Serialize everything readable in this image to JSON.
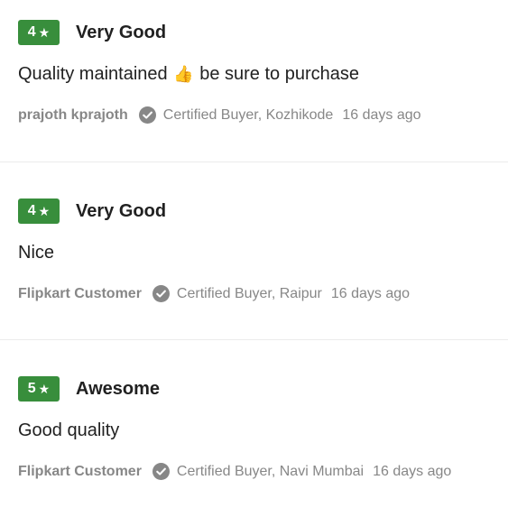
{
  "reviews": [
    {
      "rating": "4",
      "title": "Very Good",
      "body_before": "Quality maintained",
      "body_icon": "thumbs-up-icon",
      "body_after": "be sure to purchase",
      "author": "prajoth kprajoth",
      "certified": "Certified Buyer, Kozhikode",
      "date": "16 days ago"
    },
    {
      "rating": "4",
      "title": "Very Good",
      "body_before": "Nice",
      "body_after": "",
      "author": "Flipkart Customer",
      "certified": "Certified Buyer, Raipur",
      "date": "16 days ago"
    },
    {
      "rating": "5",
      "title": "Awesome",
      "body_before": "Good quality",
      "body_after": "",
      "author": "Flipkart Customer",
      "certified": "Certified Buyer, Navi Mumbai",
      "date": "16 days ago"
    }
  ],
  "colors": {
    "rating_badge": "#388e3c",
    "meta_text": "#878787",
    "divider": "#ececec"
  }
}
